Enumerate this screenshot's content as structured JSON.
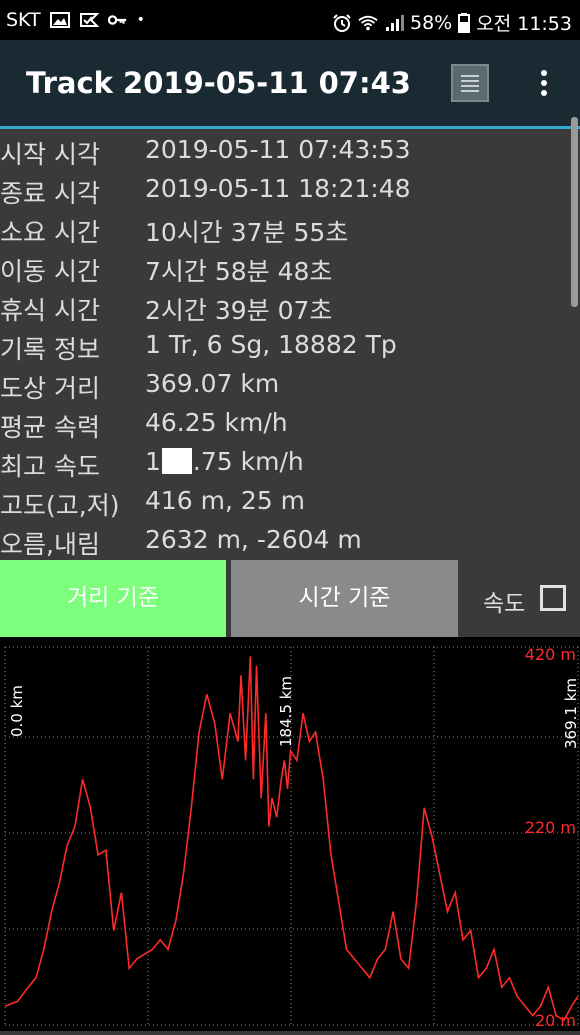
{
  "status_bar": {
    "carrier": "SKT",
    "battery": "58%",
    "time": "오전 11:53",
    "icons": [
      "gallery-icon",
      "check-flag-icon",
      "key-icon",
      "dot-icon",
      "alarm-icon",
      "wifi-icon",
      "signal-icon",
      "battery-icon"
    ]
  },
  "app_bar": {
    "title": "Track 2019-05-11 07:43",
    "icons": [
      "list-view-icon",
      "more-vert-icon"
    ]
  },
  "info": {
    "rows": [
      {
        "label": "시작 시각",
        "value": "2019-05-11 07:43:53"
      },
      {
        "label": "종료 시각",
        "value": "2019-05-11 18:21:48"
      },
      {
        "label": "소요 시간",
        "value": "10시간 37분 55초"
      },
      {
        "label": "이동 시간",
        "value": "7시간 58분 48초"
      },
      {
        "label": "휴식 시간",
        "value": "2시간 39분 07초"
      },
      {
        "label": "기록 정보",
        "value": "1 Tr, 6 Sg, 18882 Tp"
      },
      {
        "label": "도상 거리",
        "value": "369.07 km"
      },
      {
        "label": "평균 속력",
        "value": "46.25 km/h"
      },
      {
        "label": "최고 속도",
        "value_prefix": "1",
        "value_suffix": ".75 km/h"
      },
      {
        "label": "고도(고,저)",
        "value": "416 m, 25 m"
      },
      {
        "label": "오름,내림",
        "value": "2632 m, -2604 m"
      }
    ]
  },
  "tabs": {
    "distance_label": "거리 기준",
    "time_label": "시간 기준",
    "speed_label": "속도",
    "speed_checked": false,
    "active_color": "#7dff7d",
    "inactive_color": "#8a8a8a"
  },
  "chart_data": {
    "type": "line",
    "series_color": "#ff2a2a",
    "grid": true,
    "xlim": [
      0,
      369.1
    ],
    "ylim": [
      20,
      420
    ],
    "x_markers": [
      "0.0 km",
      "184.5 km",
      "369.1 km"
    ],
    "y_ticks": [
      "420 m",
      "220 m",
      "20 m"
    ],
    "x": [
      0,
      8,
      15,
      20,
      25,
      30,
      35,
      40,
      45,
      50,
      55,
      60,
      65,
      70,
      75,
      80,
      85,
      90,
      95,
      100,
      105,
      110,
      115,
      120,
      125,
      130,
      135,
      140,
      145,
      150,
      152,
      155,
      158,
      160,
      162,
      165,
      168,
      170,
      172,
      175,
      178,
      180,
      182,
      184,
      188,
      192,
      196,
      200,
      205,
      210,
      215,
      220,
      225,
      230,
      235,
      240,
      245,
      250,
      255,
      260,
      265,
      270,
      275,
      280,
      285,
      290,
      295,
      300,
      305,
      310,
      315,
      320,
      325,
      330,
      335,
      340,
      345,
      350,
      355,
      360,
      365,
      369
    ],
    "y": [
      40,
      45,
      60,
      70,
      100,
      140,
      170,
      210,
      230,
      280,
      250,
      200,
      205,
      120,
      160,
      80,
      90,
      95,
      100,
      110,
      100,
      130,
      180,
      250,
      330,
      370,
      340,
      280,
      350,
      320,
      390,
      300,
      410,
      280,
      400,
      260,
      350,
      230,
      260,
      240,
      280,
      300,
      270,
      310,
      300,
      350,
      320,
      330,
      280,
      200,
      150,
      100,
      90,
      80,
      70,
      90,
      100,
      140,
      90,
      80,
      150,
      250,
      220,
      180,
      140,
      160,
      110,
      120,
      70,
      80,
      100,
      60,
      70,
      50,
      40,
      30,
      40,
      60,
      30,
      25,
      40,
      50
    ]
  }
}
